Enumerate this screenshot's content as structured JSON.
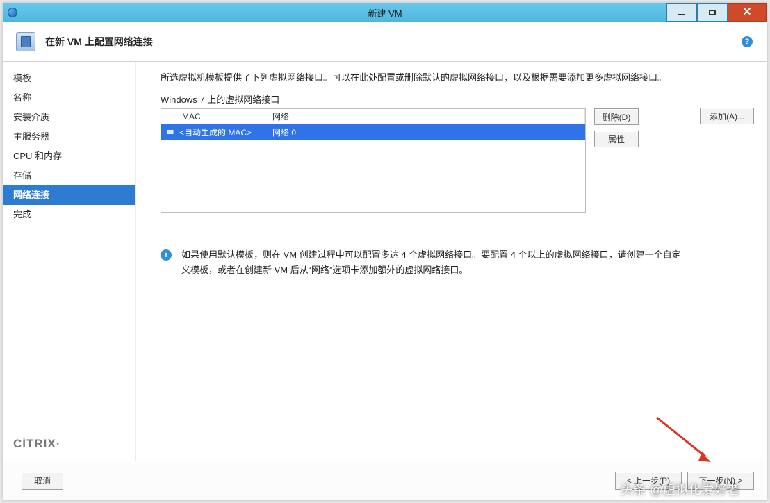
{
  "window": {
    "title": "新建 VM"
  },
  "header": {
    "title": "在新 VM 上配置网络连接"
  },
  "sidebar": {
    "items": [
      {
        "label": "模板"
      },
      {
        "label": "名称"
      },
      {
        "label": "安装介质"
      },
      {
        "label": "主服务器"
      },
      {
        "label": "CPU 和内存"
      },
      {
        "label": "存储"
      },
      {
        "label": "网络连接",
        "active": true
      },
      {
        "label": "完成"
      }
    ],
    "brand": "CİTRIX"
  },
  "main": {
    "description": "所选虚拟机模板提供了下列虚拟网络接口。可以在此处配置或删除默认的虚拟网络接口，以及根据需要添加更多虚拟网络接口。",
    "subhead": "Windows 7 上的虚拟网络接口",
    "columns": {
      "mac": "MAC",
      "net": "网络"
    },
    "rows": [
      {
        "mac": "<自动生成的 MAC>",
        "net": "网络 0"
      }
    ],
    "buttons": {
      "add": "添加(A)...",
      "delete": "删除(D)",
      "props": "属性"
    },
    "info": "如果使用默认模板，则在 VM 创建过程中可以配置多达 4 个虚拟网络接口。要配置 4 个以上的虚拟网络接口，请创建一个自定义模板，或者在创建新 VM 后从“网络”选项卡添加额外的虚拟网络接口。"
  },
  "footer": {
    "cancel": "取消",
    "prev": "< 上一步(P)",
    "next": "下一步(N) >"
  },
  "watermark": "头条 @虚拟化爱好者"
}
